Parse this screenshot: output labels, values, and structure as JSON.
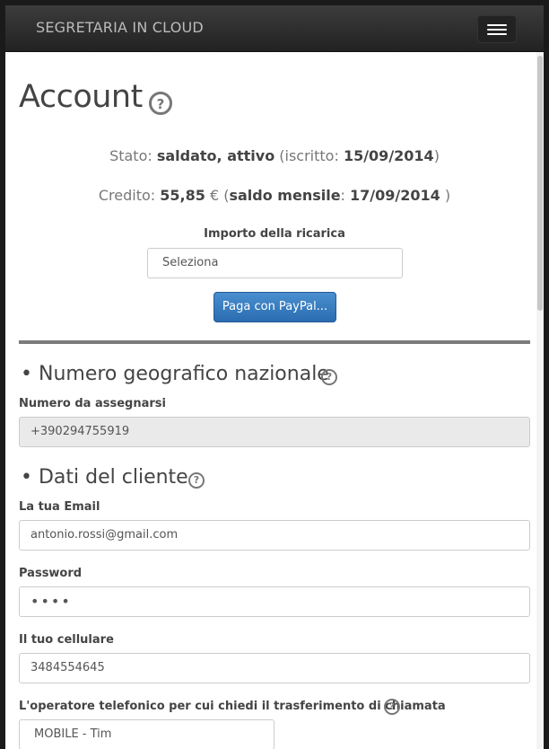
{
  "navbar": {
    "brand": "SEGRETARIA IN CLOUD",
    "menu_icon": "hamburger-menu-icon"
  },
  "page": {
    "title": "Account",
    "help_icon": "question-circle-icon"
  },
  "status": {
    "stato_label": "Stato: ",
    "stato_value": "saldato, attivo",
    "iscritto_open": " (iscritto: ",
    "iscritto_date": "15/09/2014",
    "iscritto_close": ")",
    "credito_label": "Credito: ",
    "credito_value": "55,85",
    "currency": " € (",
    "saldo_label": "saldo mensile",
    "saldo_sep": ": ",
    "saldo_date": "17/09/2014",
    "saldo_close": " )"
  },
  "ricarica": {
    "label": "Importo della ricarica",
    "selected": "Seleziona",
    "pay_button": "Paga con PayPal..."
  },
  "geo_section": {
    "bullet": "•",
    "title": "Numero geografico nazionale",
    "number_label": "Numero da assegnarsi",
    "number_value": "+390294755919"
  },
  "cliente_section": {
    "bullet": "•",
    "title": "Dati del cliente",
    "email_label": "La tua Email",
    "email_value": "antonio.rossi@gmail.com",
    "password_label": "Password",
    "password_value": "••••",
    "cellulare_label": "Il tuo cellulare",
    "cellulare_value": "3484554645",
    "operatore_label": "L'operatore telefonico per cui chiedi il trasferimento di chiamata",
    "operatore_selected": "MOBILE - Tim"
  }
}
